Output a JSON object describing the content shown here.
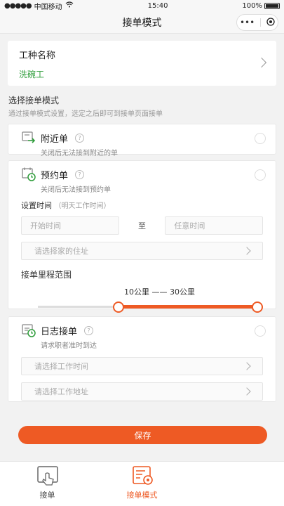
{
  "status_bar": {
    "carrier": "中国移动",
    "time": "15:40",
    "battery": "100%"
  },
  "nav": {
    "title": "接单模式"
  },
  "trade": {
    "label": "工种名称",
    "value": "洗碗工"
  },
  "section": {
    "title": "选择接单模式",
    "subtitle": "通过接单模式设置，选定之后即可到接单页面接单"
  },
  "nearby": {
    "name": "附近单",
    "desc": "关闭后无法接到附近的单"
  },
  "reserve": {
    "name": "预约单",
    "desc": "关闭后无法接到预约单",
    "time_label": "设置时间",
    "time_hint": "（明天工作时间）",
    "start_placeholder": "开始时间",
    "to": "至",
    "end_placeholder": "任意时间",
    "address_placeholder": "请选择家的住址",
    "range_label": "接单里程范围",
    "range_text": "10公里 —— 30公里",
    "range_min_km": 10,
    "range_max_km": 30
  },
  "daily": {
    "name": "日志接单",
    "desc": "请求职者准时到达",
    "time_placeholder": "请选择工作时间",
    "address_placeholder": "请选择工作地址"
  },
  "save_label": "保存",
  "tabs": [
    {
      "label": "接单",
      "icon": "hand-tap-icon"
    },
    {
      "label": "接单模式",
      "icon": "settings-doc-icon"
    }
  ],
  "colors": {
    "accent": "#ee5a24",
    "green": "#2e9d3a"
  }
}
